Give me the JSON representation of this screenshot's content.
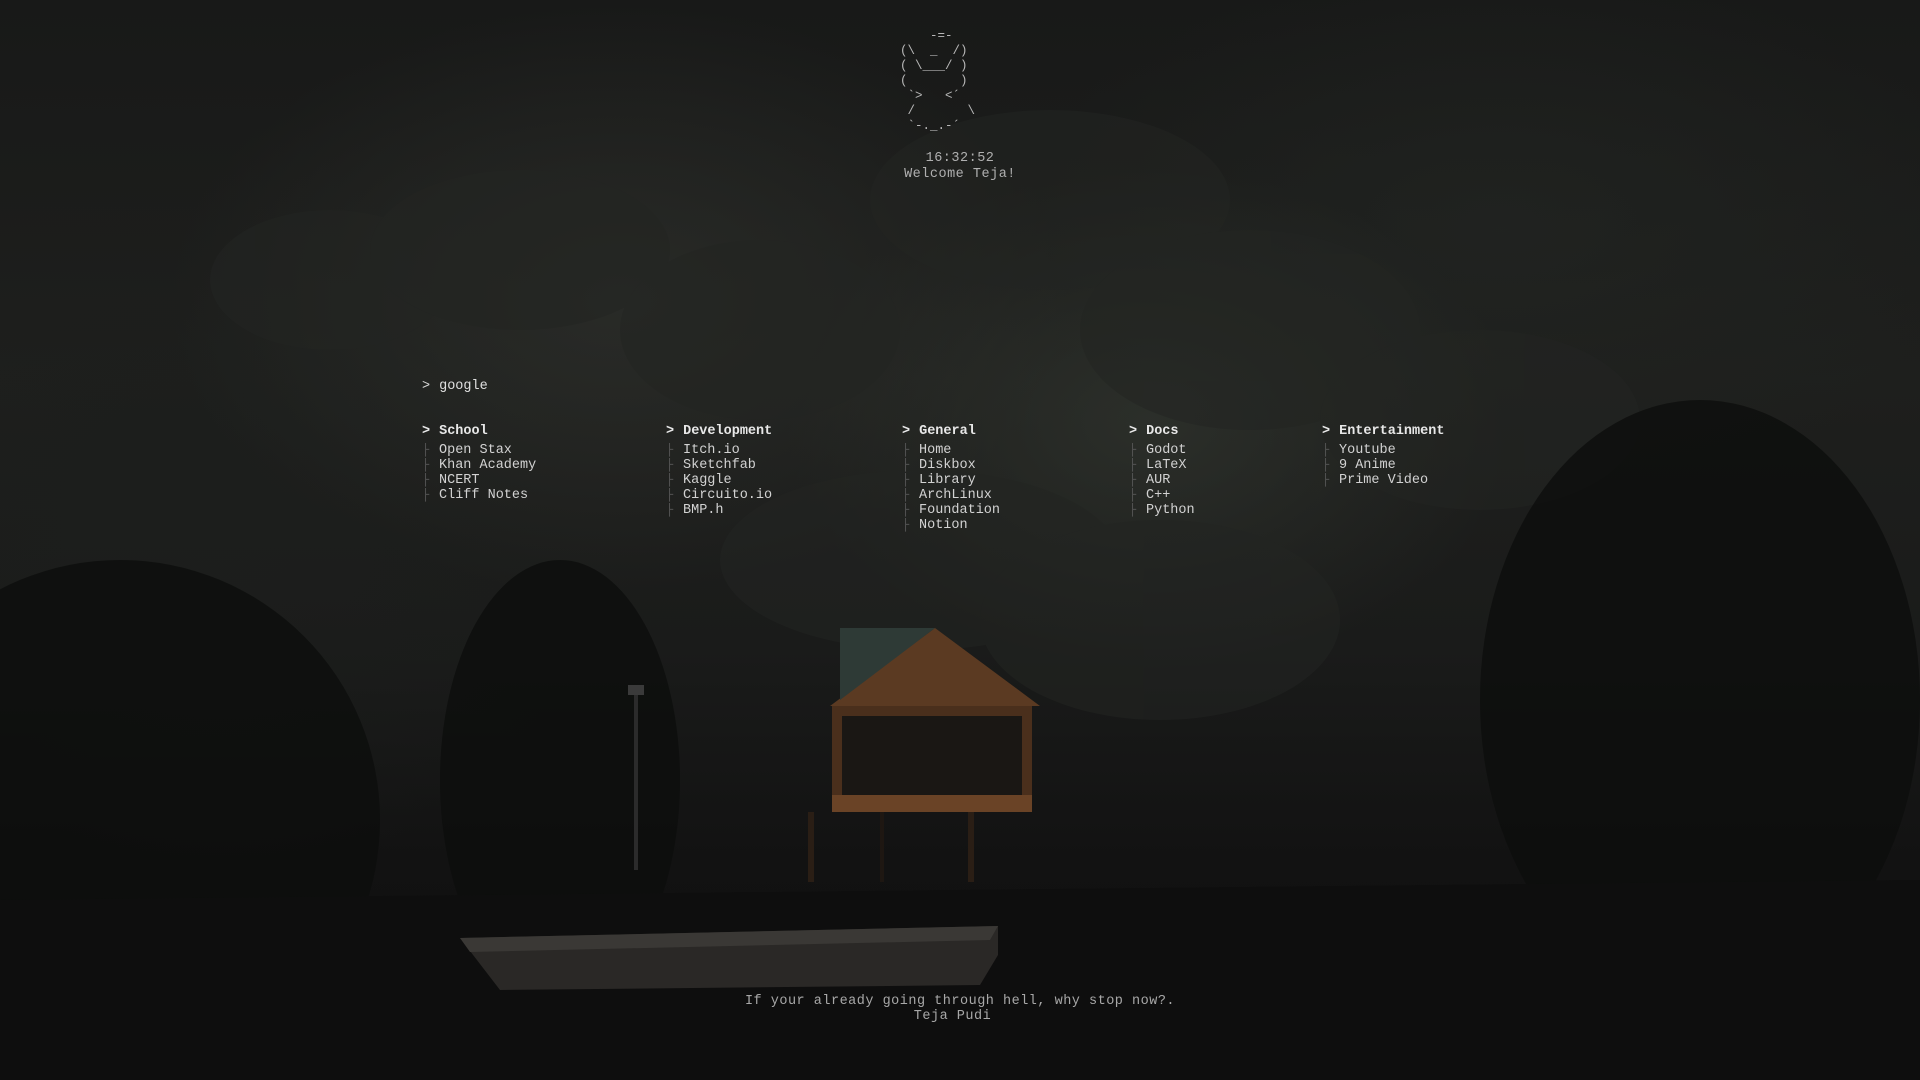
{
  "header": {
    "ascii_art": "    -=-\n(\\  _  /)\n( \\___/ )\n(       )\n `>   <´\n /       \\\n `-._.-´",
    "clock": "16:32:52",
    "welcome": "Welcome Teja!"
  },
  "search": {
    "prompt": ">",
    "placeholder": "google"
  },
  "columns": [
    {
      "title": "School",
      "links": [
        "Open Stax",
        "Khan Academy",
        "NCERT",
        "Cliff Notes"
      ]
    },
    {
      "title": "Development",
      "links": [
        "Itch.io",
        "Sketchfab",
        "Kaggle",
        "Circuito.io",
        "BMP.h"
      ]
    },
    {
      "title": "General",
      "links": [
        "Home",
        "Diskbox",
        "Library",
        "ArchLinux",
        "Foundation",
        "Notion"
      ]
    },
    {
      "title": "Docs",
      "links": [
        "Godot",
        "LaTeX",
        "AUR",
        "C++",
        "Python"
      ]
    },
    {
      "title": "Entertainment",
      "links": [
        "Youtube",
        "9 Anime",
        "Prime Video"
      ]
    }
  ],
  "quote": {
    "text": "If your already going through hell, why stop now?.",
    "author": "Teja Pudi"
  },
  "colors": {
    "background": "#0f0f0f",
    "text": "#d2d2d2",
    "heading": "#e8e8e8",
    "branch": "#5a5a5a"
  }
}
